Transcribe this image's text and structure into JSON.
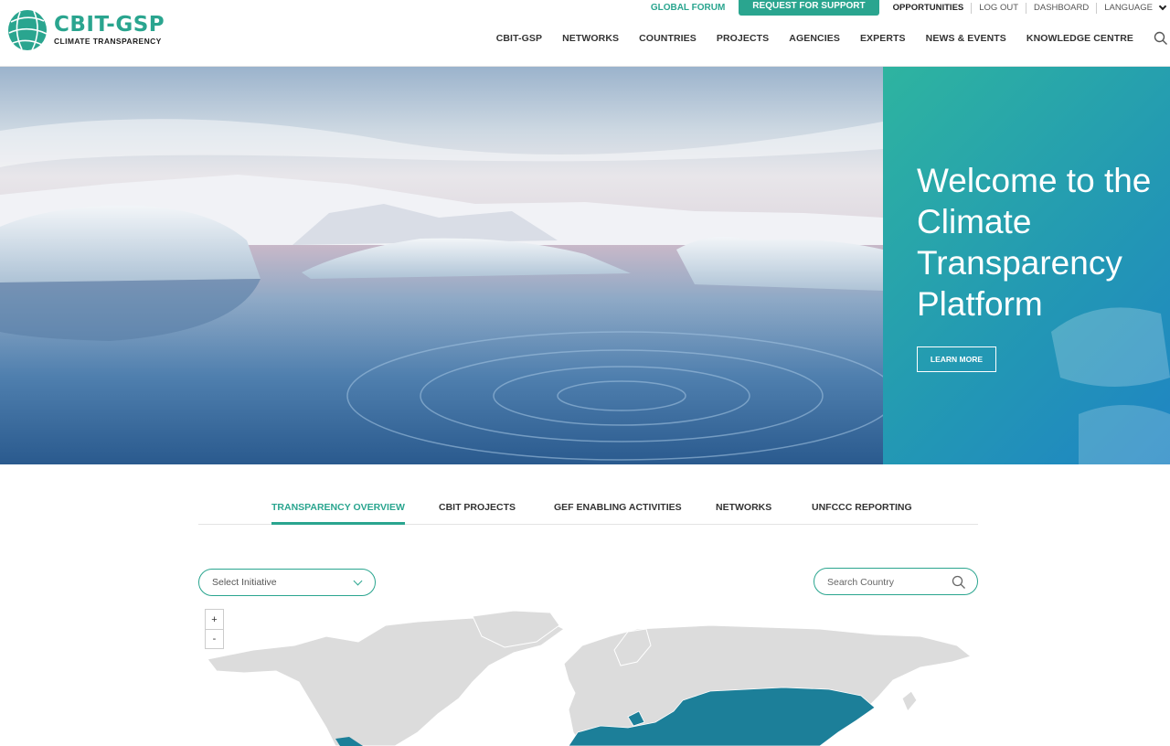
{
  "logo": {
    "title": "CBIT-GSP",
    "subtitle": "CLIMATE TRANSPARENCY"
  },
  "topbar": {
    "global_forum": "GLOBAL FORUM",
    "request_support": "REQUEST FOR SUPPORT",
    "opportunities": "OPPORTUNITIES",
    "logout": "LOG OUT",
    "dashboard": "DASHBOARD",
    "language": "LANGUAGE"
  },
  "nav": {
    "items": [
      "CBIT-GSP",
      "NETWORKS",
      "COUNTRIES",
      "PROJECTS",
      "AGENCIES",
      "EXPERTS",
      "NEWS & EVENTS",
      "KNOWLEDGE CENTRE"
    ],
    "search_icon": "search-icon"
  },
  "hero": {
    "title": "Welcome to the Climate Transparency Platform",
    "button": "LEARN MORE"
  },
  "tabs": {
    "items": [
      "TRANSPARENCY OVERVIEW",
      "CBIT PROJECTS",
      "GEF ENABLING ACTIVITIES",
      "NETWORKS",
      "UNFCCC REPORTING"
    ],
    "active": "TRANSPARENCY OVERVIEW"
  },
  "filters": {
    "initiative_placeholder": "Select Initiative",
    "country_placeholder": "Search Country"
  },
  "map": {
    "zoom_in": "+",
    "zoom_out": "-"
  },
  "colors": {
    "brand": "#2aa58f",
    "panel_start": "#2eb4a0",
    "panel_end": "#1f84c4",
    "map_land": "#dcdcdc",
    "map_highlight": "#1c7f99"
  }
}
